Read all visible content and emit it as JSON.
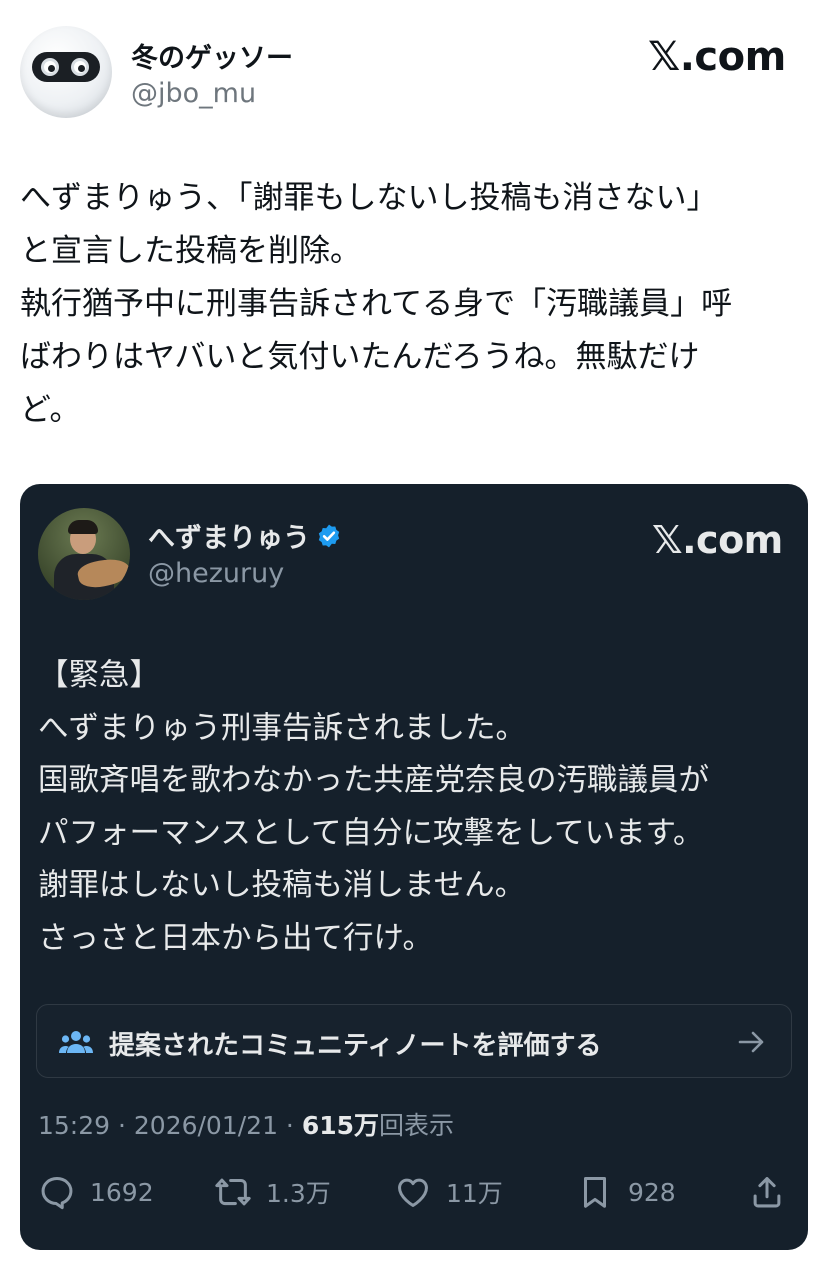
{
  "outer_post": {
    "author_name": "冬のゲッソー",
    "author_handle": "@jbo_mu",
    "brand": "𝕏.com",
    "text": "へずまりゅう、「謝罪もしないし投稿も消さない」\nと宣言した投稿を削除。\n執行猶予中に刑事告訴されてる身で「汚職議員」呼\nばわりはヤバいと気付いたんだろうね。無駄だけ\nど。"
  },
  "quoted_post": {
    "author_name": "へずまりゅう",
    "author_handle": "@hezuruy",
    "verified": true,
    "brand": "𝕏.com",
    "text": "【緊急】\nへずまりゅう刑事告訴されました。\n国歌斉唱を歌わなかった共産党奈良の汚職議員が\nパフォーマンスとして自分に攻撃をしています。\n謝罪はしないし投稿も消しません。\nさっさと日本から出て行け。",
    "community_note_label": "提案されたコミュニティノートを評価する",
    "timestamp": "15:29 · 2026/01/21 · ",
    "views_count": "615万",
    "views_suffix": "回表示",
    "actions": {
      "replies": "1692",
      "reposts": "1.3万",
      "likes": "11万",
      "bookmarks": "928"
    }
  },
  "colors": {
    "card_bg": "#15202b",
    "verified_blue": "#1d9bf0",
    "muted_text": "#8b98a5"
  },
  "icons": [
    "robot-avatar",
    "verified-badge-icon",
    "people-icon",
    "arrow-right-icon",
    "reply-icon",
    "repost-icon",
    "like-icon",
    "bookmark-icon",
    "share-icon"
  ]
}
